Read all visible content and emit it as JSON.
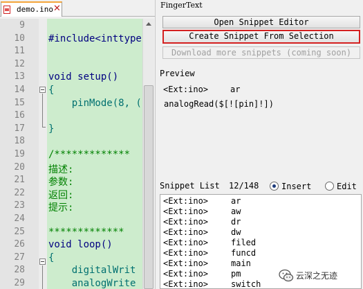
{
  "editor": {
    "tab_label": "demo.ino",
    "line_numbers": [
      "9",
      "10",
      "11",
      "12",
      "13",
      "14",
      "15",
      "16",
      "17",
      "18",
      "19",
      "20",
      "21",
      "22",
      "23",
      "24",
      "25",
      "26",
      "27",
      "28",
      "29"
    ],
    "lines": [
      "",
      "#include<inttype",
      "",
      "",
      "void setup()",
      "{",
      "    pinMode(8, (",
      "",
      "}",
      "",
      "/*************",
      "描述:",
      "参数:",
      "返回:",
      "提示:",
      "",
      "*************",
      "void loop()",
      "{",
      "    digitalWrit",
      "    analogWrite"
    ]
  },
  "panel": {
    "title": "FingerText",
    "open_editor_label": "Open Snippet Editor",
    "create_snippet_label": "Create Snippet From Selection",
    "download_label": "Download more snippets (coming soon)",
    "preview_label": "Preview",
    "preview_tag": "<Ext:ino>",
    "preview_name": "ar",
    "preview_body": "analogRead($[![pin]!])",
    "snippet_list_label": "Snippet List",
    "snippet_count": "12/148",
    "insert_label": "Insert",
    "edit_label": "Edit",
    "snippets": [
      {
        "tag": "<Ext:ino>",
        "name": "ar"
      },
      {
        "tag": "<Ext:ino>",
        "name": "aw"
      },
      {
        "tag": "<Ext:ino>",
        "name": "dr"
      },
      {
        "tag": "<Ext:ino>",
        "name": "dw"
      },
      {
        "tag": "<Ext:ino>",
        "name": "filed"
      },
      {
        "tag": "<Ext:ino>",
        "name": "funcd"
      },
      {
        "tag": "<Ext:ino>",
        "name": "main"
      },
      {
        "tag": "<Ext:ino>",
        "name": "pm"
      },
      {
        "tag": "<Ext:ino>",
        "name": "switch"
      }
    ]
  },
  "watermark": {
    "text": "云深之无迹",
    "icon": "wechat-icon"
  },
  "colors": {
    "code_bg": "#cdeccd",
    "highlight_border": "#d42020",
    "keyword": "#000080",
    "comment": "#008000"
  }
}
